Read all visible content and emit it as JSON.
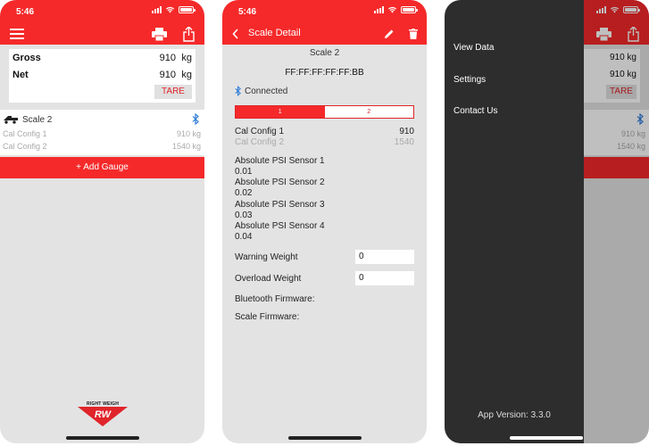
{
  "status_time": "5:46",
  "colors": {
    "accent": "#f5292a",
    "drawer": "#2d2d2d"
  },
  "scales_screen": {
    "weights": [
      {
        "label": "Gross",
        "value": "910",
        "unit": "kg"
      },
      {
        "label": "Net",
        "value": "910",
        "unit": "kg"
      }
    ],
    "tare_label": "TARE",
    "scale_item": {
      "name": "Scale 2",
      "configs": [
        {
          "label": "Cal Config 1",
          "value": "910 kg"
        },
        {
          "label": "Cal Config 2",
          "value": "1540 kg"
        }
      ]
    },
    "add_gauge_label": "+ Add Gauge",
    "logo_text": "RIGHT WEIGH",
    "logo_mark": "RW"
  },
  "detail_screen": {
    "title": "Scale Detail",
    "scale_name": "Scale 2",
    "mac": "FF:FF:FF:FF:FF:BB",
    "connection_status": "Connected",
    "segments": [
      "1",
      "2"
    ],
    "cal_configs": [
      {
        "label": "Cal Config 1",
        "value": "910"
      },
      {
        "label": "Cal Config 2",
        "value": "1540"
      }
    ],
    "sensors": [
      {
        "label": "Absolute PSI Sensor 1",
        "value": "0.01"
      },
      {
        "label": "Absolute PSI Sensor 2",
        "value": "0.02"
      },
      {
        "label": "Absolute PSI Sensor 3",
        "value": "0.03"
      },
      {
        "label": "Absolute PSI Sensor 4",
        "value": "0.04"
      }
    ],
    "warning_weight": {
      "label": "Warning Weight",
      "value": "0"
    },
    "overload_weight": {
      "label": "Overload Weight",
      "value": "0"
    },
    "bluetooth_firmware_label": "Bluetooth Firmware:",
    "scale_firmware_label": "Scale Firmware:"
  },
  "menu_screen": {
    "items": [
      "View Data",
      "Settings",
      "Contact Us"
    ],
    "version": "App Version: 3.3.0",
    "background_values": [
      "910 kg",
      "910 kg",
      "910 kg",
      "1540 kg"
    ],
    "background_tare": "TARE"
  }
}
